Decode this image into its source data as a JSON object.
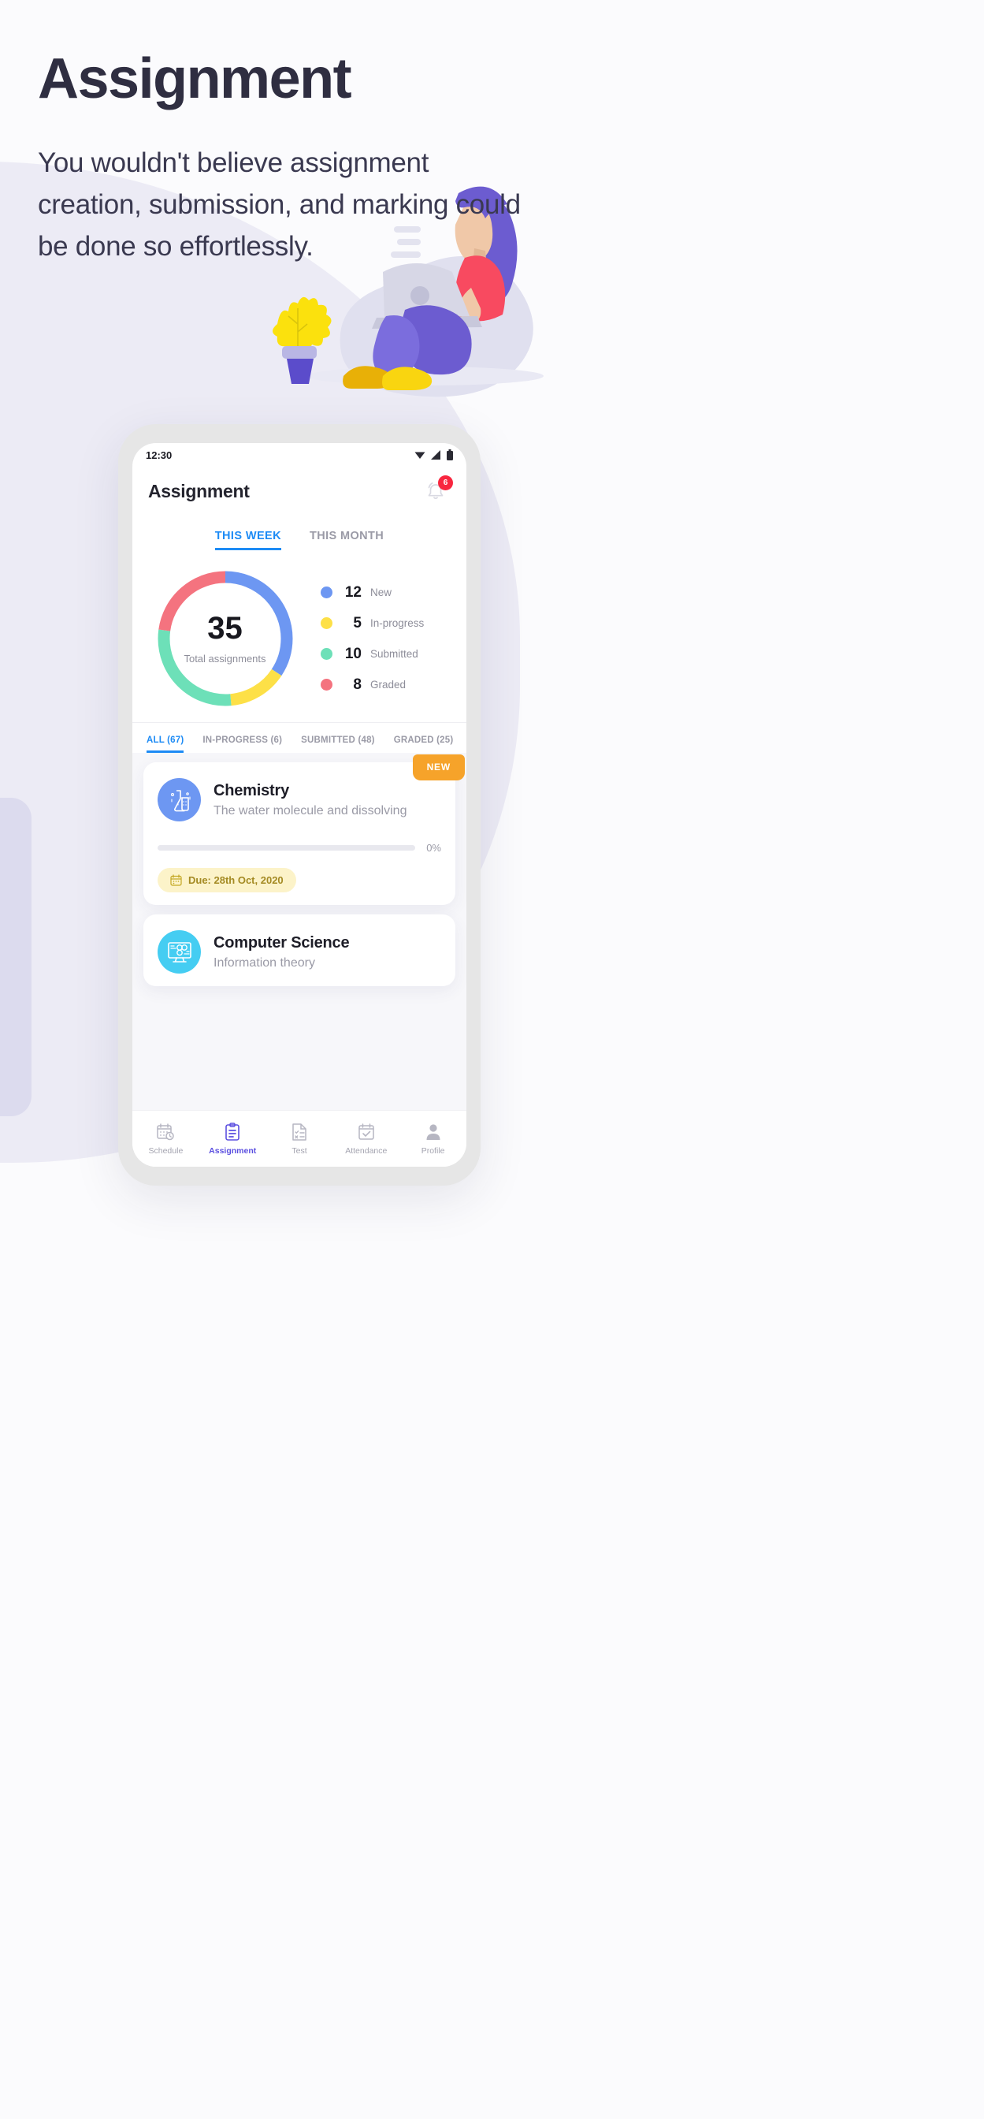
{
  "hero": {
    "title": "Assignment",
    "paragraph": "You wouldn't believe assignment creation, submission, and marking could be done so effortlessly."
  },
  "phone": {
    "statusbar": {
      "time": "12:30",
      "icons": [
        "wifi-icon",
        "cellular-signal-icon",
        "battery-icon"
      ]
    },
    "header": {
      "title": "Assignment",
      "bell_icon": "notification-bell-icon",
      "badge_count": "6"
    },
    "period_tabs": [
      {
        "label": "THIS WEEK",
        "active": true
      },
      {
        "label": "THIS MONTH",
        "active": false
      }
    ],
    "summary": {
      "total_value": "35",
      "total_label": "Total assignments"
    },
    "filter_tabs": [
      {
        "label": "ALL (67)",
        "active": true
      },
      {
        "label": "IN-PROGRESS (6)",
        "active": false
      },
      {
        "label": "SUBMITTED (48)",
        "active": false
      },
      {
        "label": "GRADED (25)",
        "active": false
      }
    ],
    "assignments": [
      {
        "subject": "Chemistry",
        "topic": "The water molecule and dissolving",
        "flag": "NEW",
        "progress_pct": "0%",
        "progress_value": 0,
        "due": "Due: 28th Oct, 2020",
        "icon": "chemistry-flask-icon",
        "icon_color": "#6d97f2"
      },
      {
        "subject": "Computer Science",
        "topic": "Information theory",
        "icon": "computer-monitor-icon",
        "icon_color": "#45cdf2"
      }
    ],
    "bottom_nav": [
      {
        "label": "Schedule",
        "icon": "calendar-clock-icon",
        "active": false
      },
      {
        "label": "Assignment",
        "icon": "clipboard-icon",
        "active": true
      },
      {
        "label": "Test",
        "icon": "test-paper-icon",
        "active": false
      },
      {
        "label": "Attendance",
        "icon": "calendar-check-icon",
        "active": false
      },
      {
        "label": "Profile",
        "icon": "person-icon",
        "active": false
      }
    ]
  },
  "chart_data": {
    "type": "pie",
    "title": "Total assignments",
    "total": 35,
    "categories": [
      "New",
      "In-progress",
      "Submitted",
      "Graded"
    ],
    "values": [
      12,
      5,
      10,
      8
    ],
    "colors": [
      "#6d97f2",
      "#fde047",
      "#6de0b8",
      "#f4737f"
    ],
    "legend": "right",
    "donut": true
  }
}
